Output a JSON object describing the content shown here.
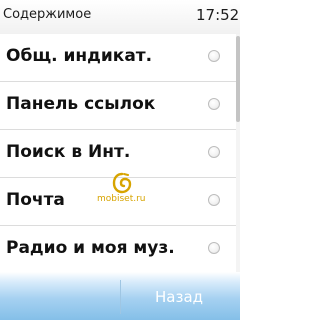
{
  "status_bar": {
    "title": "Содержимое",
    "time": "17:52"
  },
  "list": {
    "items": [
      {
        "label": "Общ. индикат.",
        "checked": false
      },
      {
        "label": "Панель ссылок",
        "checked": false
      },
      {
        "label": "Поиск в Инт.",
        "checked": false
      },
      {
        "label": "Почта",
        "checked": false
      },
      {
        "label": "Радио и моя муз.",
        "checked": false
      }
    ]
  },
  "watermark": {
    "text": "mobiset.ru"
  },
  "softkeys": {
    "left_label": "",
    "right_label": "Назад"
  },
  "colors": {
    "softkey_gradient_bottom": "#84bfe8",
    "watermark": "#d7a400"
  }
}
